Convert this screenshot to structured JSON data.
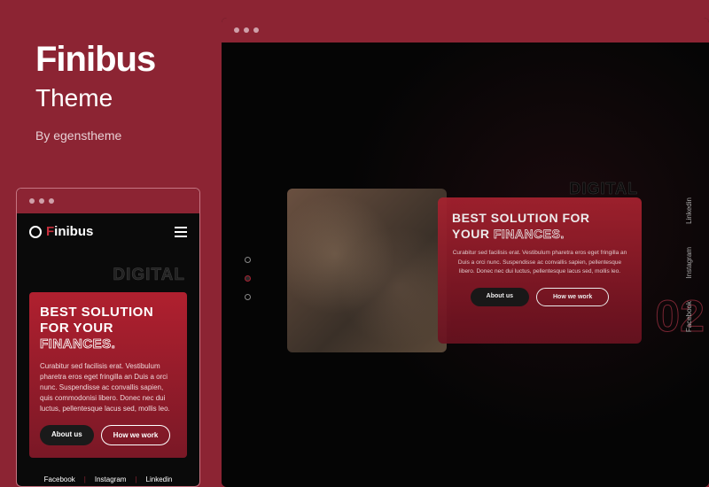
{
  "header": {
    "title": "Finibus",
    "subtitle": "Theme",
    "author": "By egenstheme"
  },
  "mobile": {
    "logo_text": "inibus",
    "bg_text": "DIGITAL",
    "card": {
      "title_part1": "BEST SOLUTION FOR YOUR ",
      "title_outline": "FINANCES.",
      "description": "Curabitur sed facilisis erat. Vestibulum pharetra eros eget fringilla an Duis a orci nunc. Suspendisse ac convallis sapien, quis commodonisi libero. Donec nec dui luctus, pellentesque lacus sed, mollis leo."
    },
    "buttons": {
      "about": "About us",
      "how_work": "How we work"
    },
    "socials": {
      "facebook": "Facebook",
      "instagram": "Instagram",
      "linkedin": "Linkedin"
    }
  },
  "desktop": {
    "bg_text_1": "DIGITAL",
    "bg_num": "02",
    "card": {
      "title_part1": "BEST SOLUTION FOR YOUR ",
      "title_outline": "FINANCES.",
      "description": "Curabitur sed facilisis erat. Vestibulum pharetra eros eget fringilla an Duis a orci nunc. Suspendisse ac convallis sapien, pellentesque libero. Donec nec dui luctus, pellentesque lacus sed, mollis leo."
    },
    "buttons": {
      "about": "About us",
      "how_work": "How we work"
    },
    "side_socials": {
      "linkedin": "Linkedin",
      "instagram": "Instagram",
      "facebook": "Facebook"
    }
  }
}
